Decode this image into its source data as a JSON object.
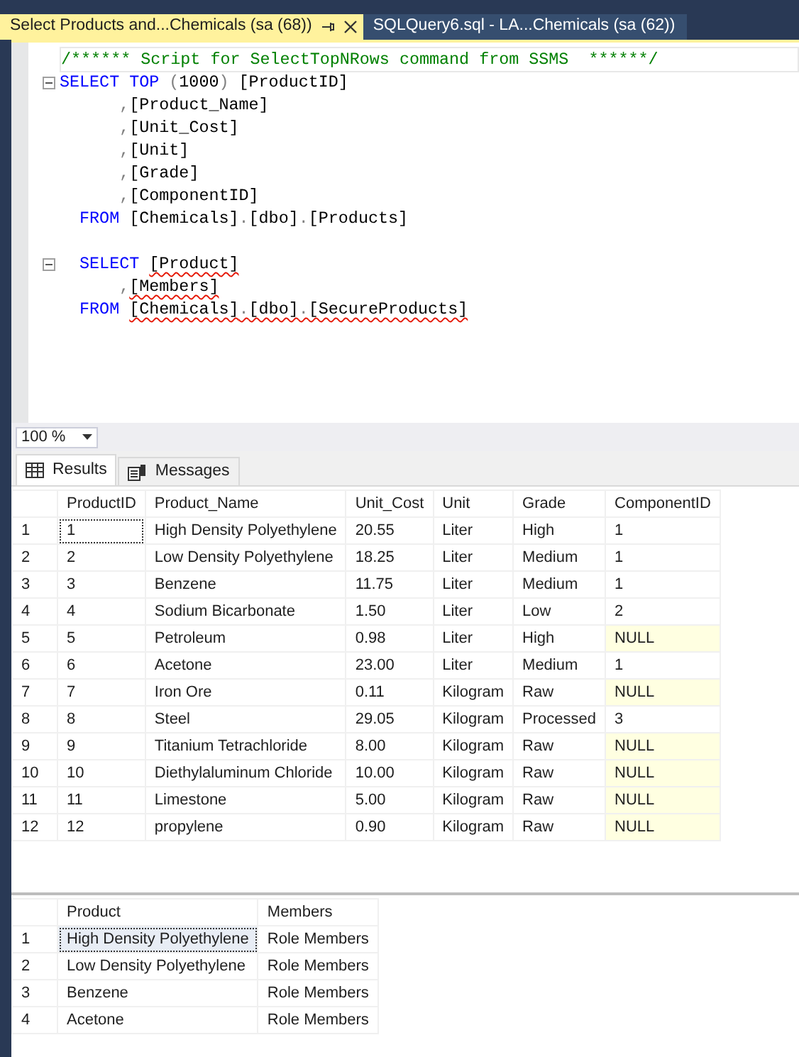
{
  "document_tabs": [
    {
      "label": "Select Products and...Chemicals (sa (68))",
      "selected": true
    },
    {
      "label": "SQLQuery6.sql - LA...Chemicals (sa (62))",
      "selected": false
    }
  ],
  "editor": {
    "lines": [
      {
        "kind": "code",
        "current": true,
        "tokens": [
          {
            "text": "/****** Script for SelectTopNRows command from SSMS  ******/",
            "kind": "comment"
          }
        ]
      },
      {
        "kind": "code",
        "fold": true,
        "tokens": [
          {
            "text": "SELECT TOP",
            "kind": "keyword"
          },
          {
            "text": " (",
            "kind": "punct"
          },
          {
            "text": "1000",
            "kind": "plain"
          },
          {
            "text": ")",
            "kind": "punct"
          },
          {
            "text": " [ProductID]",
            "kind": "plain"
          }
        ]
      },
      {
        "kind": "code",
        "tokens": [
          {
            "text": "      ,",
            "kind": "punct"
          },
          {
            "text": "[Product_Name]",
            "kind": "plain"
          }
        ]
      },
      {
        "kind": "code",
        "tokens": [
          {
            "text": "      ,",
            "kind": "punct"
          },
          {
            "text": "[Unit_Cost]",
            "kind": "plain"
          }
        ]
      },
      {
        "kind": "code",
        "tokens": [
          {
            "text": "      ,",
            "kind": "punct"
          },
          {
            "text": "[Unit]",
            "kind": "plain"
          }
        ]
      },
      {
        "kind": "code",
        "tokens": [
          {
            "text": "      ,",
            "kind": "punct"
          },
          {
            "text": "[Grade]",
            "kind": "plain"
          }
        ]
      },
      {
        "kind": "code",
        "tokens": [
          {
            "text": "      ,",
            "kind": "punct"
          },
          {
            "text": "[ComponentID]",
            "kind": "plain"
          }
        ]
      },
      {
        "kind": "code",
        "tokens": [
          {
            "text": "  FROM",
            "kind": "keyword"
          },
          {
            "text": " [Chemicals]",
            "kind": "plain"
          },
          {
            "text": ".",
            "kind": "punct"
          },
          {
            "text": "[dbo]",
            "kind": "plain"
          },
          {
            "text": ".",
            "kind": "punct"
          },
          {
            "text": "[Products]",
            "kind": "plain"
          }
        ]
      },
      {
        "kind": "blank"
      },
      {
        "kind": "code",
        "fold": true,
        "tokens": [
          {
            "text": "  SELECT ",
            "kind": "keyword"
          },
          {
            "text": "[Product]",
            "kind": "plain",
            "squiggle": true
          }
        ]
      },
      {
        "kind": "code",
        "tokens": [
          {
            "text": "      ,",
            "kind": "punct"
          },
          {
            "text": "[Members]",
            "kind": "plain",
            "squiggle": true
          }
        ]
      },
      {
        "kind": "code",
        "tokens": [
          {
            "text": "  FROM ",
            "kind": "keyword"
          },
          {
            "text": "[Chemicals]",
            "kind": "plain",
            "squiggle": true
          },
          {
            "text": ".",
            "kind": "punct",
            "squiggle": true
          },
          {
            "text": "[dbo]",
            "kind": "plain",
            "squiggle": true
          },
          {
            "text": ".",
            "kind": "punct",
            "squiggle": true
          },
          {
            "text": "[SecureProducts]",
            "kind": "plain",
            "squiggle": true
          }
        ]
      }
    ]
  },
  "zoom": {
    "value": "100 %"
  },
  "result_tabs": [
    {
      "label": "Results",
      "selected": true,
      "kind": "grid"
    },
    {
      "label": "Messages",
      "selected": false,
      "kind": "messages"
    }
  ],
  "grids": [
    {
      "columns": [
        "ProductID",
        "Product_Name",
        "Unit_Cost",
        "Unit",
        "Grade",
        "ComponentID"
      ],
      "rows": [
        {
          "number": "1",
          "cells": [
            {
              "text": "1",
              "focused": true
            },
            "High Density Polyethylene",
            "20.55",
            "Liter",
            "High",
            "1"
          ]
        },
        {
          "number": "2",
          "cells": [
            "2",
            "Low Density Polyethylene",
            "18.25",
            "Liter",
            "Medium",
            "1"
          ]
        },
        {
          "number": "3",
          "cells": [
            "3",
            "Benzene",
            "11.75",
            "Liter",
            "Medium",
            "1"
          ]
        },
        {
          "number": "4",
          "cells": [
            "4",
            "Sodium Bicarbonate",
            "1.50",
            "Liter",
            "Low",
            "2"
          ]
        },
        {
          "number": "5",
          "cells": [
            "5",
            "Petroleum",
            "0.98",
            "Liter",
            "High",
            {
              "text": "NULL",
              "kind": "null"
            }
          ]
        },
        {
          "number": "6",
          "cells": [
            "6",
            "Acetone",
            "23.00",
            "Liter",
            "Medium",
            "1"
          ]
        },
        {
          "number": "7",
          "cells": [
            "7",
            "Iron Ore",
            "0.11",
            "Kilogram",
            "Raw",
            {
              "text": "NULL",
              "kind": "null"
            }
          ]
        },
        {
          "number": "8",
          "cells": [
            "8",
            "Steel",
            "29.05",
            "Kilogram",
            "Processed",
            "3"
          ]
        },
        {
          "number": "9",
          "cells": [
            "9",
            "Titanium Tetrachloride",
            "8.00",
            "Kilogram",
            "Raw",
            {
              "text": "NULL",
              "kind": "null"
            }
          ]
        },
        {
          "number": "10",
          "cells": [
            "10",
            "Diethylaluminum Chloride",
            "10.00",
            "Kilogram",
            "Raw",
            {
              "text": "NULL",
              "kind": "null"
            }
          ]
        },
        {
          "number": "11",
          "cells": [
            "11",
            "Limestone",
            "5.00",
            "Kilogram",
            "Raw",
            {
              "text": "NULL",
              "kind": "null"
            }
          ]
        },
        {
          "number": "12",
          "cells": [
            "12",
            "propylene",
            "0.90",
            "Kilogram",
            "Raw",
            {
              "text": "NULL",
              "kind": "null"
            }
          ]
        }
      ]
    },
    {
      "columns": [
        "Product",
        "Members"
      ],
      "rows": [
        {
          "number": "1",
          "cells": [
            {
              "text": "High Density Polyethylene",
              "focused": true
            },
            "Role Members"
          ]
        },
        {
          "number": "2",
          "cells": [
            "Low Density Polyethylene",
            "Role Members"
          ]
        },
        {
          "number": "3",
          "cells": [
            "Benzene",
            "Role Members"
          ]
        },
        {
          "number": "4",
          "cells": [
            "Acetone",
            "Role Members"
          ]
        }
      ]
    }
  ]
}
